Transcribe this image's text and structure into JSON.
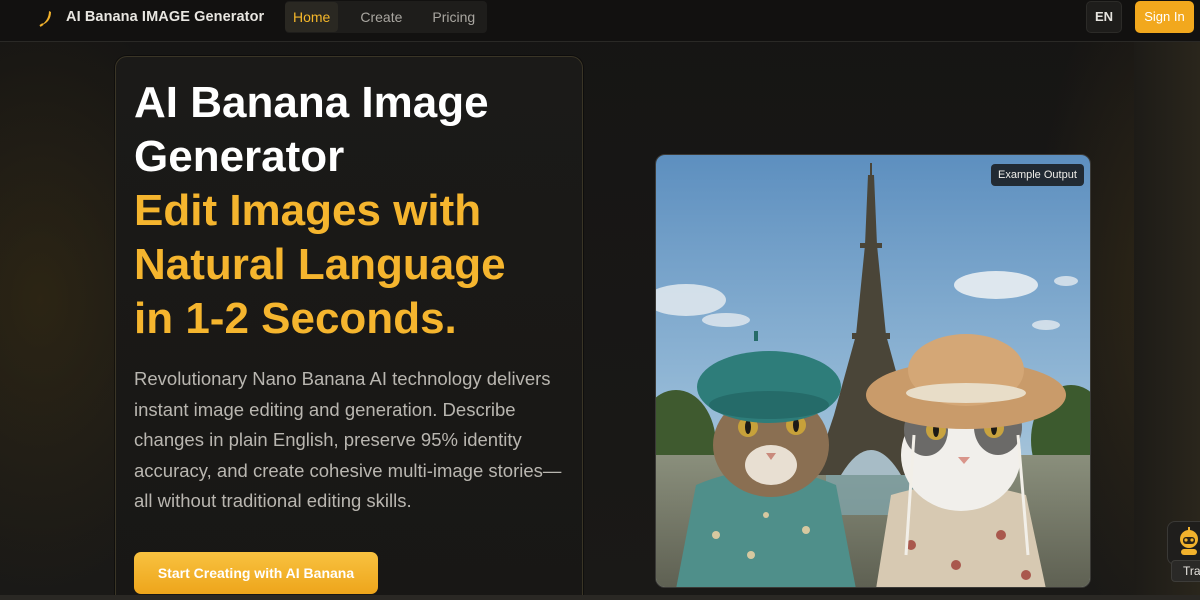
{
  "nav": {
    "brand": "AI Banana IMAGE Generator",
    "links": [
      {
        "label": "Home",
        "active": true
      },
      {
        "label": "Create",
        "active": false
      },
      {
        "label": "Pricing",
        "active": false
      }
    ],
    "language": "EN",
    "sign_in": "Sign In"
  },
  "hero": {
    "title_line1": "AI Banana Image",
    "title_line2": "Generator",
    "accent_line1": "Edit Images with",
    "accent_line2": "Natural Language",
    "accent_line3": "in 1-2 Seconds.",
    "description": "Revolutionary Nano Banana AI technology delivers instant image editing and generation. Describe changes in plain English, preserve 95% identity accuracy, and create cohesive multi-image stories—all without traditional editing skills.",
    "cta": "Start Creating with AI Banana"
  },
  "example": {
    "badge": "Example Output",
    "image_icon": "two-cats-eiffel-tower-image"
  },
  "widget": {
    "icon": "robot-mascot-icon",
    "tooltip": "Tra"
  },
  "colors": {
    "accent": "#f5b52e",
    "button": "#f2a81d",
    "background": "#141312"
  }
}
